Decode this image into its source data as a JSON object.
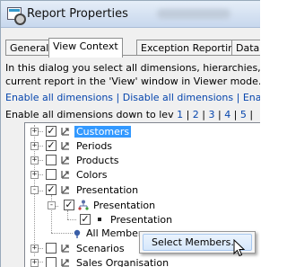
{
  "window": {
    "title": "Report Properties"
  },
  "tabs": [
    {
      "label": "General"
    },
    {
      "label": "View Context"
    },
    {
      "label": "Exception Reporting"
    },
    {
      "label": "Data"
    }
  ],
  "description": {
    "line1": "In this dialog you select all dimensions, hierarchies,",
    "line2": "current report in the 'View' window in Viewer mode."
  },
  "links": {
    "enable_all": "Enable all dimensions",
    "separator": " | ",
    "disable_all": "Disable all dimensions",
    "truncated": "Ena",
    "down_to_prefix": "Enable all dimensions down to lev",
    "levels": [
      "1",
      "2",
      "3",
      "4",
      "5"
    ]
  },
  "tree": {
    "nodes": [
      {
        "label": "Customers",
        "checked": true,
        "expander": "+"
      },
      {
        "label": "Periods",
        "checked": true,
        "expander": "+"
      },
      {
        "label": "Products",
        "checked": false,
        "expander": "+"
      },
      {
        "label": "Colors",
        "checked": false,
        "expander": "+"
      },
      {
        "label": "Presentation",
        "checked": true,
        "expander": "-"
      },
      {
        "label": "Presentation",
        "checked": true,
        "expander": "-"
      },
      {
        "label": "Presentation",
        "checked": true,
        "expander": ""
      },
      {
        "label": "All Members",
        "checked": false,
        "expander": ""
      },
      {
        "label": "Scenarios",
        "checked": false,
        "expander": "+"
      },
      {
        "label": "Sales Organisation",
        "checked": false,
        "expander": "+"
      }
    ]
  },
  "context_menu": {
    "item": "Select Members..."
  },
  "colors": {
    "selection": "#3399ff",
    "link": "#0645ad",
    "check": "#111111"
  }
}
